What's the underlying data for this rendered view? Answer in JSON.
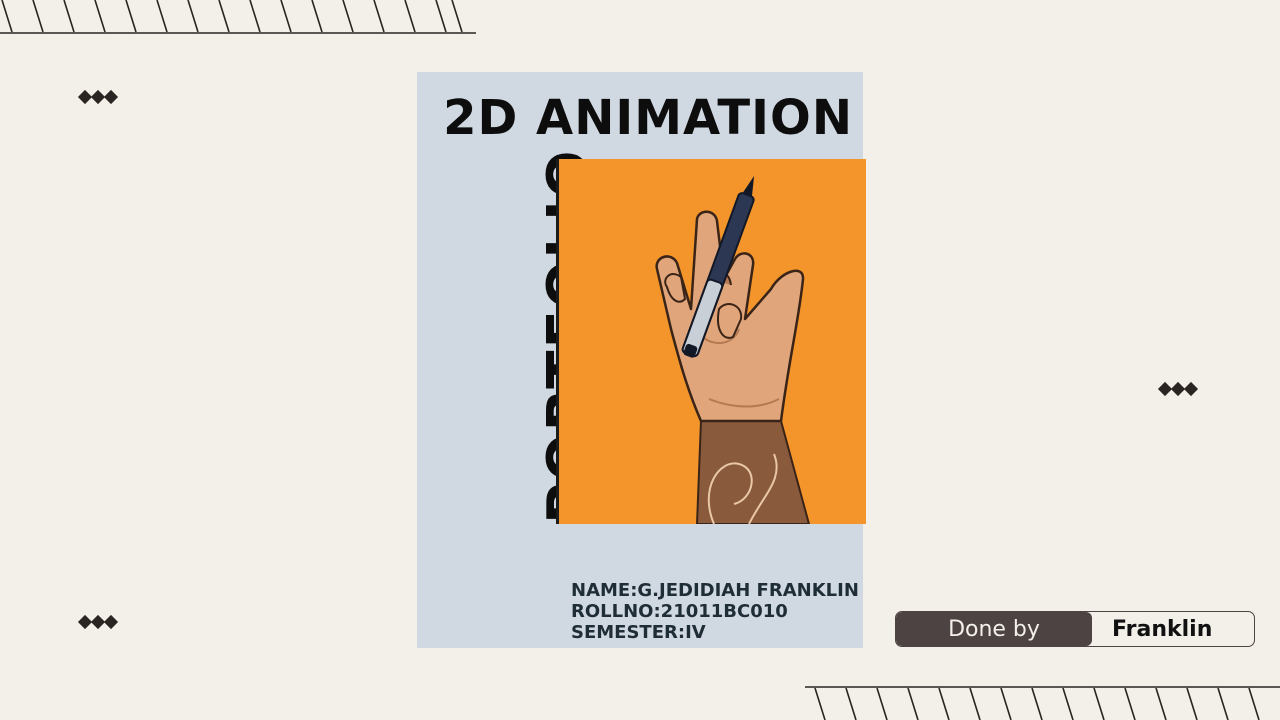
{
  "cover": {
    "title": "2D ANIMATION",
    "side_title": "PORTFOLIO",
    "name_line": "NAME:G.JEDIDIAH FRANKLIN",
    "roll_line": "ROLLNO:21011BC010",
    "semester_line": "SEMESTER:IV"
  },
  "credit": {
    "label": "Done by",
    "name": "Franklin"
  },
  "colors": {
    "background": "#f3efe9",
    "cover_background": "#d0d8e2",
    "art_background": "#f3952b",
    "credit_dark": "#4d4342",
    "diamond": "#2a2522"
  },
  "decorations": {
    "hatch_icon": "diagonal-hatch-line",
    "diamond_icon": "triple-diamond",
    "art_icon": "hand-holding-pen-illustration"
  }
}
